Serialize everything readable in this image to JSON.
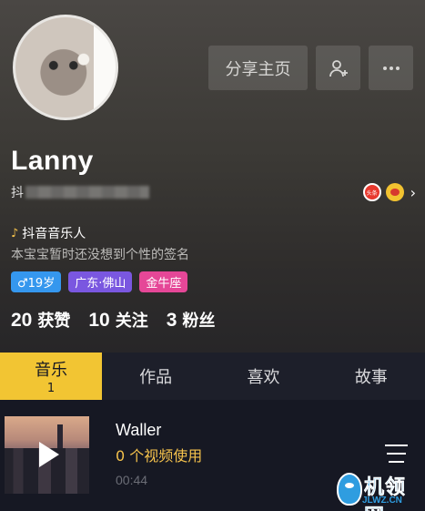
{
  "profile": {
    "name": "Lanny",
    "id_prefix": "抖",
    "musician_label": "抖音音乐人",
    "signature": "本宝宝暂时还没想到个性的签名"
  },
  "header_buttons": {
    "share_label": "分享主页",
    "add_icon": "add-friend-icon",
    "more_icon": "more-icon"
  },
  "social": {
    "toutiao_label": "头条",
    "weibo_icon": "weibo-icon"
  },
  "tags": {
    "age": "♂19岁",
    "location": "广东·佛山",
    "zodiac": "金牛座"
  },
  "stats": [
    {
      "value": "20",
      "label": "获赞"
    },
    {
      "value": "10",
      "label": "关注"
    },
    {
      "value": "3",
      "label": "粉丝"
    }
  ],
  "tabs": [
    {
      "label": "音乐",
      "count": "1",
      "active": true
    },
    {
      "label": "作品",
      "active": false
    },
    {
      "label": "喜欢",
      "active": false
    },
    {
      "label": "故事",
      "active": false
    }
  ],
  "song": {
    "title": "Waller",
    "usage": "0 个视频使用",
    "duration": "00:44"
  },
  "watermark": {
    "text": "机领网",
    "url": "JLWZ.CN"
  },
  "colors": {
    "accent": "#f2c533",
    "background": "#161823",
    "tag_age": "#3597ee",
    "tag_location": "#7a57e0",
    "tag_zodiac": "#e54797"
  }
}
